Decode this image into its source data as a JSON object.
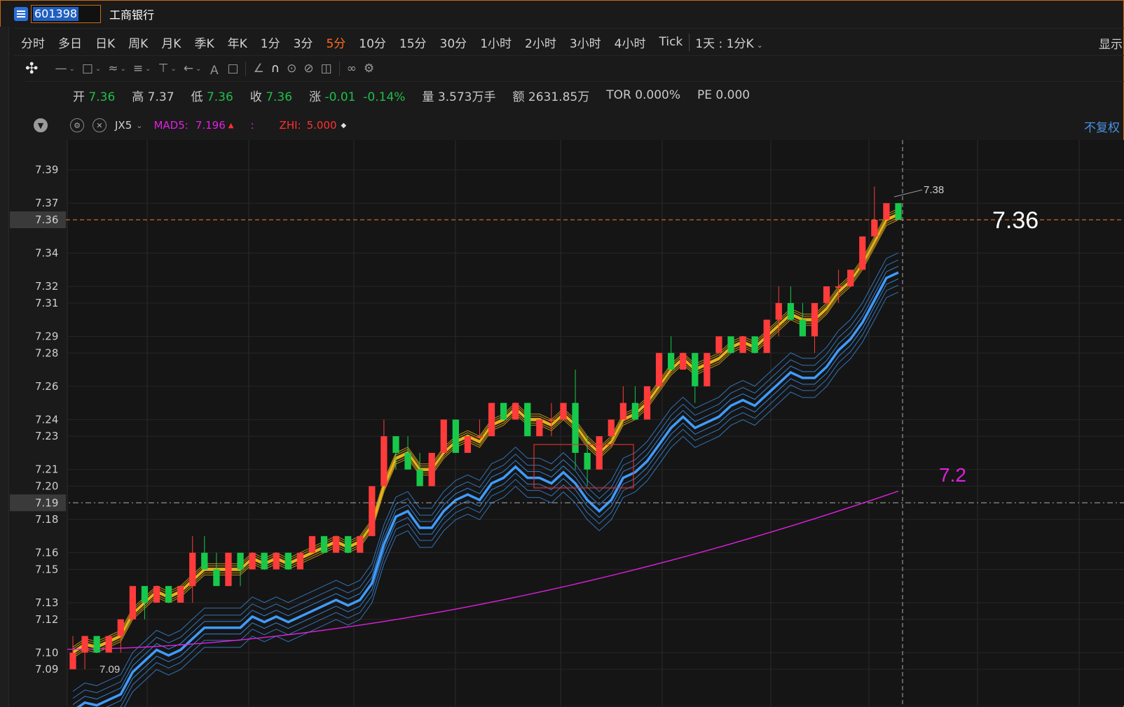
{
  "title_bar": {
    "code": "601398",
    "name": "工商银行"
  },
  "periods": [
    "分时",
    "多日",
    "日K",
    "周K",
    "月K",
    "季K",
    "年K",
    "1分",
    "3分",
    "5分",
    "10分",
    "15分",
    "30分",
    "1小时",
    "2小时",
    "3小时",
    "4小时",
    "Tick"
  ],
  "active_period": "5分",
  "range_selector": "1天 : 1分K",
  "show_button": "显示",
  "quote": {
    "open_label": "开",
    "open": "7.36",
    "high_label": "高",
    "high": "7.37",
    "low_label": "低",
    "low": "7.36",
    "close_label": "收",
    "close": "7.36",
    "change_label": "涨",
    "change": "-0.01",
    "change_pct": "-0.14%",
    "volume_label": "量",
    "volume": "3.573万手",
    "amount_label": "额",
    "amount": "2631.85万",
    "tor": "TOR 0.000%",
    "pe": "PE 0.000"
  },
  "indicator": {
    "name": "JX5",
    "mad_label": "MAD5:",
    "mad_value": "7.196",
    "colon": ":",
    "zhi_label": "ZHI:",
    "zhi_value": "5.000",
    "fuquan": "不复权"
  },
  "colors": {
    "up": "#ff3b3b",
    "down": "#17c94a",
    "gold": "#e8b21a",
    "blue": "#3f9cff",
    "magenta": "#e020e0",
    "accent": "#ff6a1a"
  },
  "chart_data": {
    "type": "candlestick",
    "ylim": [
      7.085,
      7.397
    ],
    "y_ticks": [
      "7.39",
      "7.37",
      "7.36",
      "7.34",
      "7.32",
      "7.31",
      "7.29",
      "7.28",
      "7.26",
      "7.24",
      "7.23",
      "7.21",
      "7.20",
      "7.19",
      "7.18",
      "7.16",
      "7.15",
      "7.13",
      "7.12",
      "7.10",
      "7.09"
    ],
    "last_price": 7.36,
    "last_price_label": "7.36",
    "last_price_big": "7.36",
    "crosshair_price": "7.19",
    "crosshair_value": 7.19,
    "magenta_value_label": "7.2",
    "max_label": "7.38",
    "min_label": "7.09",
    "candles_ohlc": [
      [
        7.09,
        7.11,
        7.09,
        7.1
      ],
      [
        7.1,
        7.11,
        7.09,
        7.11
      ],
      [
        7.11,
        7.11,
        7.1,
        7.1
      ],
      [
        7.1,
        7.11,
        7.1,
        7.11
      ],
      [
        7.11,
        7.12,
        7.1,
        7.12
      ],
      [
        7.12,
        7.14,
        7.12,
        7.14
      ],
      [
        7.14,
        7.14,
        7.12,
        7.13
      ],
      [
        7.13,
        7.14,
        7.13,
        7.14
      ],
      [
        7.14,
        7.14,
        7.13,
        7.13
      ],
      [
        7.13,
        7.14,
        7.13,
        7.14
      ],
      [
        7.14,
        7.17,
        7.13,
        7.16
      ],
      [
        7.16,
        7.17,
        7.15,
        7.15
      ],
      [
        7.15,
        7.16,
        7.14,
        7.14
      ],
      [
        7.14,
        7.16,
        7.14,
        7.16
      ],
      [
        7.16,
        7.16,
        7.14,
        7.15
      ],
      [
        7.15,
        7.16,
        7.15,
        7.16
      ],
      [
        7.16,
        7.16,
        7.15,
        7.15
      ],
      [
        7.15,
        7.16,
        7.15,
        7.16
      ],
      [
        7.16,
        7.16,
        7.15,
        7.15
      ],
      [
        7.15,
        7.16,
        7.15,
        7.16
      ],
      [
        7.16,
        7.17,
        7.16,
        7.17
      ],
      [
        7.17,
        7.17,
        7.16,
        7.16
      ],
      [
        7.16,
        7.17,
        7.16,
        7.17
      ],
      [
        7.17,
        7.17,
        7.16,
        7.16
      ],
      [
        7.16,
        7.17,
        7.16,
        7.17
      ],
      [
        7.17,
        7.2,
        7.17,
        7.2
      ],
      [
        7.2,
        7.24,
        7.2,
        7.23
      ],
      [
        7.23,
        7.23,
        7.21,
        7.22
      ],
      [
        7.22,
        7.23,
        7.21,
        7.21
      ],
      [
        7.21,
        7.22,
        7.2,
        7.2
      ],
      [
        7.2,
        7.22,
        7.2,
        7.22
      ],
      [
        7.22,
        7.24,
        7.22,
        7.24
      ],
      [
        7.24,
        7.24,
        7.22,
        7.22
      ],
      [
        7.22,
        7.23,
        7.22,
        7.23
      ],
      [
        7.23,
        7.24,
        7.23,
        7.23
      ],
      [
        7.23,
        7.25,
        7.23,
        7.25
      ],
      [
        7.25,
        7.25,
        7.24,
        7.24
      ],
      [
        7.24,
        7.25,
        7.24,
        7.25
      ],
      [
        7.25,
        7.25,
        7.23,
        7.23
      ],
      [
        7.23,
        7.24,
        7.23,
        7.24
      ],
      [
        7.24,
        7.25,
        7.23,
        7.24
      ],
      [
        7.24,
        7.25,
        7.24,
        7.25
      ],
      [
        7.25,
        7.27,
        7.21,
        7.22
      ],
      [
        7.22,
        7.23,
        7.2,
        7.21
      ],
      [
        7.21,
        7.23,
        7.21,
        7.23
      ],
      [
        7.23,
        7.24,
        7.23,
        7.24
      ],
      [
        7.24,
        7.26,
        7.24,
        7.25
      ],
      [
        7.25,
        7.26,
        7.24,
        7.24
      ],
      [
        7.24,
        7.26,
        7.24,
        7.26
      ],
      [
        7.26,
        7.28,
        7.26,
        7.28
      ],
      [
        7.28,
        7.29,
        7.27,
        7.27
      ],
      [
        7.27,
        7.28,
        7.27,
        7.28
      ],
      [
        7.28,
        7.28,
        7.25,
        7.26
      ],
      [
        7.26,
        7.28,
        7.26,
        7.28
      ],
      [
        7.28,
        7.29,
        7.28,
        7.29
      ],
      [
        7.29,
        7.29,
        7.28,
        7.28
      ],
      [
        7.28,
        7.29,
        7.28,
        7.29
      ],
      [
        7.29,
        7.29,
        7.28,
        7.28
      ],
      [
        7.28,
        7.3,
        7.28,
        7.3
      ],
      [
        7.3,
        7.32,
        7.29,
        7.31
      ],
      [
        7.31,
        7.32,
        7.3,
        7.3
      ],
      [
        7.3,
        7.31,
        7.29,
        7.29
      ],
      [
        7.29,
        7.31,
        7.28,
        7.31
      ],
      [
        7.31,
        7.32,
        7.31,
        7.32
      ],
      [
        7.32,
        7.33,
        7.31,
        7.32
      ],
      [
        7.32,
        7.33,
        7.32,
        7.33
      ],
      [
        7.33,
        7.35,
        7.33,
        7.35
      ],
      [
        7.35,
        7.38,
        7.35,
        7.36
      ],
      [
        7.36,
        7.37,
        7.36,
        7.37
      ],
      [
        7.37,
        7.37,
        7.36,
        7.36
      ]
    ]
  }
}
